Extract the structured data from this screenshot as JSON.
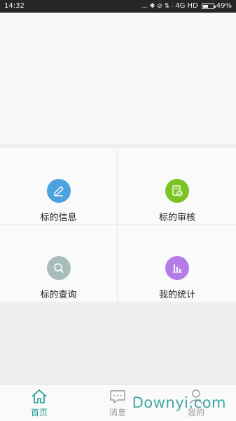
{
  "status_bar": {
    "time": "14:32",
    "icons_text": "... ✱ ⊘ ⇅ ⫶",
    "network": "4G HD",
    "battery_percent": "49%",
    "battery_level": 0.49
  },
  "grid": {
    "items": [
      {
        "label": "标的信息",
        "icon": "edit-icon",
        "color": "#4aa3df"
      },
      {
        "label": "标的审核",
        "icon": "audit-check-icon",
        "color": "#7cc423"
      },
      {
        "label": "标的查询",
        "icon": "search-icon",
        "color": "#a8bcbc"
      },
      {
        "label": "我的统计",
        "icon": "bar-chart-icon",
        "color": "#b57ce8"
      }
    ]
  },
  "tabbar": {
    "tabs": [
      {
        "label": "首页",
        "icon": "home-icon",
        "active": true
      },
      {
        "label": "消息",
        "icon": "message-icon",
        "active": false
      },
      {
        "label": "我的",
        "icon": "profile-icon",
        "active": false
      }
    ],
    "active_color": "#1c9a95",
    "inactive_color": "#9a9a9a"
  },
  "watermark": "Downyi.com"
}
